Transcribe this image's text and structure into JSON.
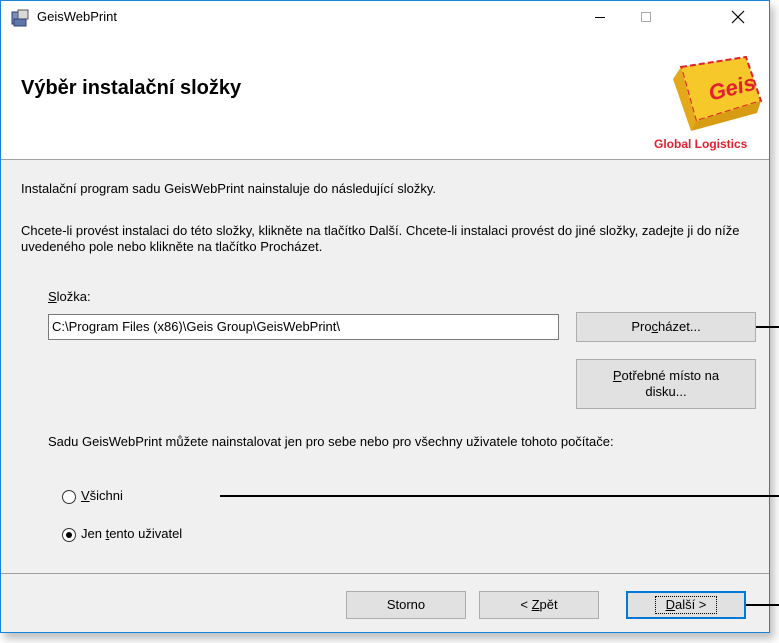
{
  "window": {
    "title": "GeisWebPrint"
  },
  "header": {
    "title": "Výběr instalační složky",
    "logo_text": "Geis",
    "logo_caption": "Global Logistics",
    "colors": {
      "logo_yellow": "#f7c82a",
      "logo_red": "#e2202e"
    }
  },
  "body": {
    "intro": "Instalační program sadu GeisWebPrint nainstaluje do následující složky.",
    "instructions": "Chcete-li provést instalaci do této složky, klikněte na tlačítko Další. Chcete-li instalaci provést do jiné složky, zadejte ji do níže uvedeného pole nebo klikněte na tlačítko Procházet.",
    "folder_label_prefix": "S",
    "folder_label_rest": "ložka:",
    "folder_value": "C:\\Program Files (x86)\\Geis Group\\GeisWebPrint\\",
    "browse_btn": {
      "pre": "Pro",
      "ul": "c",
      "post": "házet..."
    },
    "disk_btn": {
      "ul": "P",
      "line1": "otřebné místo na",
      "line2": "disku..."
    },
    "users_text": "Sadu GeisWebPrint můžete nainstalovat jen pro sebe nebo pro všechny uživatele tohoto počítače:",
    "radio_all": {
      "ul": "V",
      "rest": "šichni",
      "checked": false
    },
    "radio_me": {
      "pre": "Jen ",
      "ul": "t",
      "rest": "ento uživatel",
      "checked": true
    }
  },
  "footer": {
    "cancel": "Storno",
    "back": {
      "pre": "< ",
      "ul": "Z",
      "rest": "pět"
    },
    "next": {
      "ul": "D",
      "rest": "alší >"
    }
  }
}
